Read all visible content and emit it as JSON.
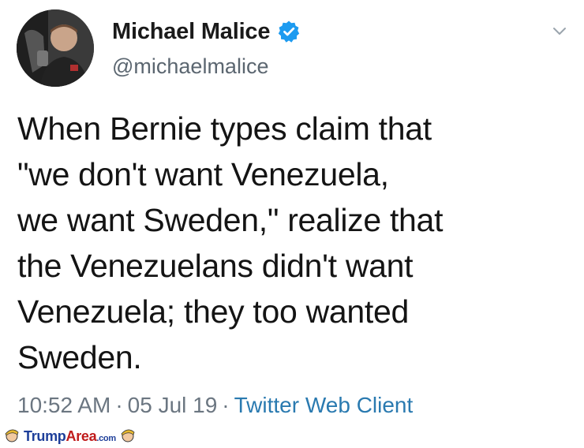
{
  "tweet": {
    "display_name": "Michael Malice",
    "handle": "@michaelmalice",
    "text": "When Bernie types claim that\n\"we don't want Venezuela,\nwe want Sweden,\" realize that\nthe Venezuelans didn't want\nVenezuela; they too wanted\nSweden.",
    "time": "10:52 AM",
    "date": "05 Jul 19",
    "separator": "·",
    "client": "Twitter Web Client",
    "verified_icon": "verified-badge-icon",
    "menu_icon": "chevron-down-icon"
  },
  "watermark": {
    "brand_part1": "Trump",
    "brand_part2": "Area",
    "brand_suffix": ".com"
  },
  "colors": {
    "verified_blue": "#1d9bf0",
    "client_link": "#2a7ab0",
    "handle_gray": "#5b6670",
    "watermark_blue": "#1e3f9a",
    "watermark_red": "#c01b1b"
  }
}
